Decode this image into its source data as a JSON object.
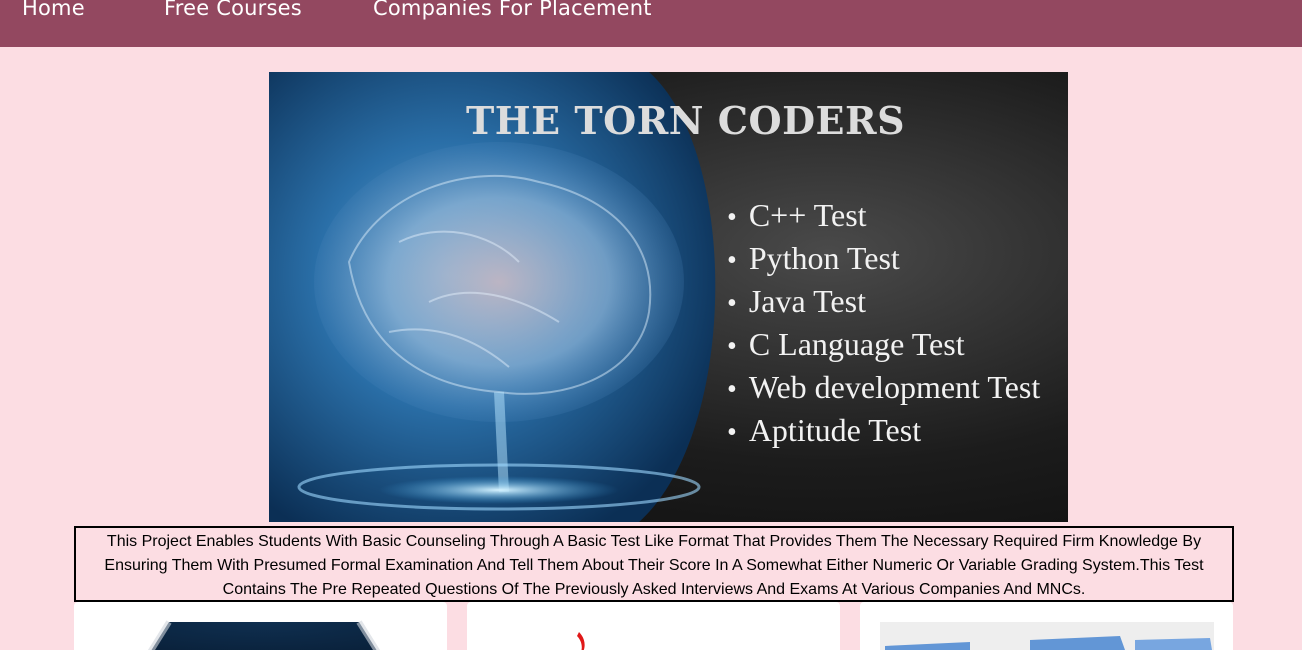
{
  "nav": {
    "items": [
      {
        "label": "Home"
      },
      {
        "label": "Free Courses"
      },
      {
        "label": "Companies For Placement"
      }
    ]
  },
  "banner": {
    "title": "THE TORN CODERS",
    "tests": [
      "C++ Test",
      "Python Test",
      "Java Test",
      "C Language Test",
      "Web development Test",
      "Aptitude Test"
    ]
  },
  "description": "This Project Enables Students With Basic Counseling Through A Basic Test Like Format That Provides Them The Necessary Required Firm Knowledge By Ensuring Them With Presumed Formal Examination And Tell Them About Their Score In A Somewhat Either Numeric Or Variable Grading System.This Test Contains The Pre Repeated Questions Of The Previously Asked Interviews And Exams At Various Companies And MNCs.",
  "colors": {
    "page_background": "#fcdde3",
    "navbar": "#934860",
    "banner_dark": "#1c1c1c",
    "brain_blue": "#2a6fa8"
  },
  "cards": [
    {
      "image": "course-card-image-1"
    },
    {
      "image": "course-card-image-2"
    },
    {
      "image": "course-card-image-3"
    }
  ]
}
